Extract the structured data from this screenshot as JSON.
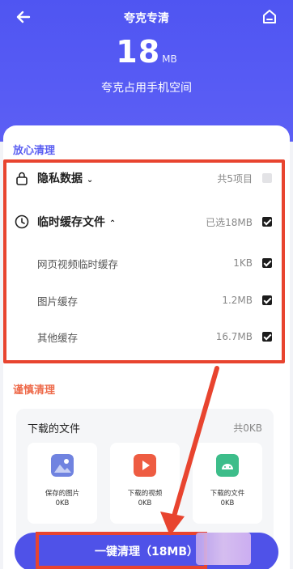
{
  "header": {
    "title": "夸克专清",
    "size_number": "18",
    "size_unit": "MB",
    "subtitle": "夸克占用手机空间"
  },
  "safe_section": {
    "title": "放心清理",
    "rows": [
      {
        "label": "隐私数据",
        "value": "共5项目",
        "checked": false
      },
      {
        "label": "临时缓存文件",
        "value": "已选18MB",
        "checked": true
      },
      {
        "label": "网页视频临时缓存",
        "value": "1KB",
        "checked": true
      },
      {
        "label": "图片缓存",
        "value": "1.2MB",
        "checked": true
      },
      {
        "label": "其他缓存",
        "value": "16.7MB",
        "checked": true
      }
    ]
  },
  "careful_section": {
    "title": "谨慎清理",
    "card": {
      "title": "下载的文件",
      "count": "共0KB",
      "tiles": [
        {
          "label": "保存的图片",
          "size": "0KB",
          "icon": "image-icon",
          "color": "#6f7bd9"
        },
        {
          "label": "下载的视频",
          "size": "0KB",
          "icon": "play-video-icon",
          "color": "#ee5c42"
        },
        {
          "label": "下载的文件",
          "size": "0KB",
          "icon": "android-file-icon",
          "color": "#3dbd8a"
        }
      ]
    }
  },
  "clean_button": {
    "label": "一键清理（18MB）"
  },
  "colors": {
    "accent": "#5b5ff2",
    "highlight": "#e8442f",
    "button": "#4f52e8"
  }
}
